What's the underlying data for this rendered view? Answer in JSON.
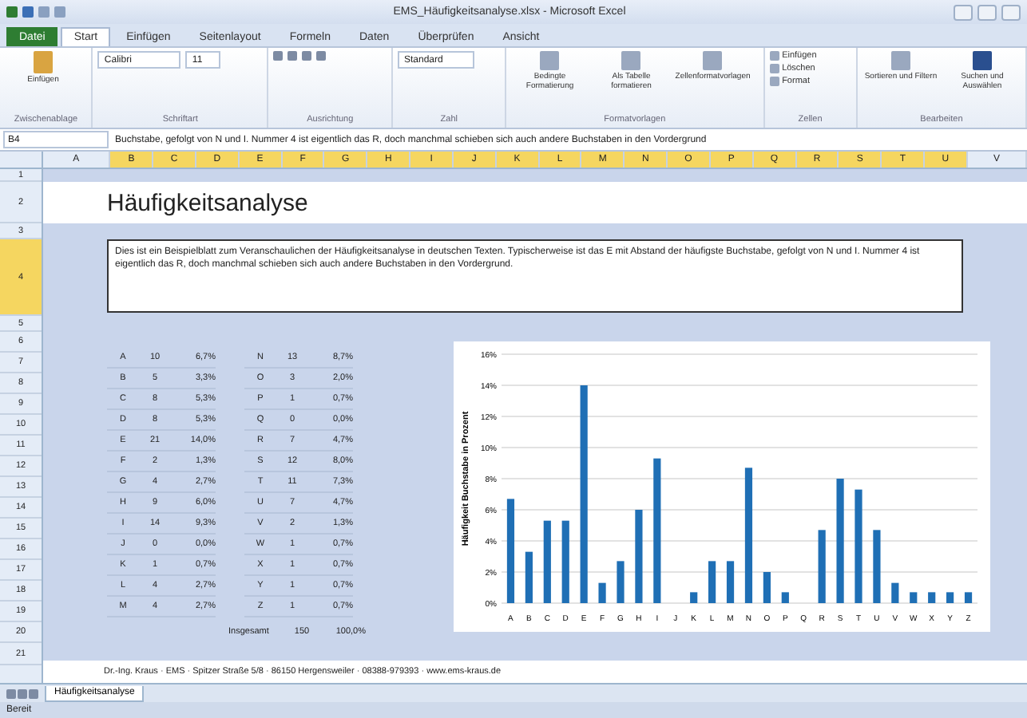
{
  "title_bar": {
    "title": "EMS_Häufigkeitsanalyse.xlsx - Microsoft Excel"
  },
  "ribbon": {
    "file_tab": "Datei",
    "tabs": [
      {
        "label": "Start",
        "selected": true
      },
      {
        "label": "Einfügen",
        "selected": false
      },
      {
        "label": "Seitenlayout",
        "selected": false
      },
      {
        "label": "Formeln",
        "selected": false
      },
      {
        "label": "Daten",
        "selected": false
      },
      {
        "label": "Überprüfen",
        "selected": false
      },
      {
        "label": "Ansicht",
        "selected": false
      }
    ],
    "paste_button": "Einfügen",
    "font": "Calibri",
    "font_size": "11",
    "number_format": "Standard",
    "style_buttons": [
      "Bedingte Formatierung",
      "Als Tabelle formatieren",
      "Zellenformatvorlagen"
    ],
    "cell_buttons": [
      "Einfügen",
      "Löschen",
      "Format"
    ],
    "edit_buttons": [
      "Sortieren und Filtern",
      "Suchen und Auswählen"
    ],
    "groups": [
      "Zwischenablage",
      "Schriftart",
      "Ausrichtung",
      "Zahl",
      "Formatvorlagen",
      "Zellen",
      "Bearbeiten"
    ]
  },
  "formula_bar": {
    "cell": "B4",
    "value": "Buchstabe, gefolgt von N und I. Nummer 4 ist eigentlich das R, doch manchmal schieben sich auch andere Buchstaben in den Vordergrund"
  },
  "columns": [
    {
      "label": "A",
      "selected": false
    },
    {
      "label": "B",
      "selected": true
    },
    {
      "label": "C",
      "selected": true
    },
    {
      "label": "D",
      "selected": true
    },
    {
      "label": "E",
      "selected": true
    },
    {
      "label": "F",
      "selected": true
    },
    {
      "label": "G",
      "selected": true
    },
    {
      "label": "H",
      "selected": true
    },
    {
      "label": "I",
      "selected": true
    },
    {
      "label": "J",
      "selected": true
    },
    {
      "label": "K",
      "selected": true
    },
    {
      "label": "L",
      "selected": true
    },
    {
      "label": "M",
      "selected": true
    },
    {
      "label": "N",
      "selected": true
    },
    {
      "label": "O",
      "selected": true
    },
    {
      "label": "P",
      "selected": true
    },
    {
      "label": "Q",
      "selected": true
    },
    {
      "label": "R",
      "selected": true
    },
    {
      "label": "S",
      "selected": true
    },
    {
      "label": "T",
      "selected": true
    },
    {
      "label": "U",
      "selected": true
    },
    {
      "label": "V",
      "selected": false
    }
  ],
  "row_numbers": [
    {
      "label": "1",
      "selected": false
    },
    {
      "label": "2",
      "selected": false
    },
    {
      "label": "3",
      "selected": false
    },
    {
      "label": "4",
      "selected": true
    },
    {
      "label": "5",
      "selected": false
    },
    {
      "label": "6",
      "selected": false
    },
    {
      "label": "7",
      "selected": false
    },
    {
      "label": "8",
      "selected": false
    },
    {
      "label": "9",
      "selected": false
    },
    {
      "label": "10",
      "selected": false
    },
    {
      "label": "11",
      "selected": false
    },
    {
      "label": "12",
      "selected": false
    },
    {
      "label": "13",
      "selected": false
    },
    {
      "label": "14",
      "selected": false
    },
    {
      "label": "15",
      "selected": false
    },
    {
      "label": "16",
      "selected": false
    },
    {
      "label": "17",
      "selected": false
    },
    {
      "label": "18",
      "selected": false
    },
    {
      "label": "19",
      "selected": false
    },
    {
      "label": "20",
      "selected": false
    },
    {
      "label": "21",
      "selected": false
    }
  ],
  "sheet": {
    "title": "Häufigkeitsanalyse",
    "description": "Dies ist ein Beispielblatt zum Veranschaulichen der Häufigkeitsanalyse in deutschen Texten. Typischerweise ist das E mit Abstand der häufigste Buchstabe, gefolgt von N und I. Nummer 4 ist eigentlich das R, doch manchmal schieben sich auch andere Buchstaben in den Vordergrund.",
    "table_left": [
      {
        "letter": "A",
        "count": "10",
        "percent": "6,7%"
      },
      {
        "letter": "B",
        "count": "5",
        "percent": "3,3%"
      },
      {
        "letter": "C",
        "count": "8",
        "percent": "5,3%"
      },
      {
        "letter": "D",
        "count": "8",
        "percent": "5,3%"
      },
      {
        "letter": "E",
        "count": "21",
        "percent": "14,0%"
      },
      {
        "letter": "F",
        "count": "2",
        "percent": "1,3%"
      },
      {
        "letter": "G",
        "count": "4",
        "percent": "2,7%"
      },
      {
        "letter": "H",
        "count": "9",
        "percent": "6,0%"
      },
      {
        "letter": "I",
        "count": "14",
        "percent": "9,3%"
      },
      {
        "letter": "J",
        "count": "0",
        "percent": "0,0%"
      },
      {
        "letter": "K",
        "count": "1",
        "percent": "0,7%"
      },
      {
        "letter": "L",
        "count": "4",
        "percent": "2,7%"
      },
      {
        "letter": "M",
        "count": "4",
        "percent": "2,7%"
      }
    ],
    "table_right": [
      {
        "letter": "N",
        "count": "13",
        "percent": "8,7%"
      },
      {
        "letter": "O",
        "count": "3",
        "percent": "2,0%"
      },
      {
        "letter": "P",
        "count": "1",
        "percent": "0,7%"
      },
      {
        "letter": "Q",
        "count": "0",
        "percent": "0,0%"
      },
      {
        "letter": "R",
        "count": "7",
        "percent": "4,7%"
      },
      {
        "letter": "S",
        "count": "12",
        "percent": "8,0%"
      },
      {
        "letter": "T",
        "count": "11",
        "percent": "7,3%"
      },
      {
        "letter": "U",
        "count": "7",
        "percent": "4,7%"
      },
      {
        "letter": "V",
        "count": "2",
        "percent": "1,3%"
      },
      {
        "letter": "W",
        "count": "1",
        "percent": "0,7%"
      },
      {
        "letter": "X",
        "count": "1",
        "percent": "0,7%"
      },
      {
        "letter": "Y",
        "count": "1",
        "percent": "0,7%"
      },
      {
        "letter": "Z",
        "count": "1",
        "percent": "0,7%"
      }
    ],
    "total": {
      "label": "Insgesamt",
      "count": "150",
      "percent": "100,0%"
    },
    "chart_data": {
      "type": "bar",
      "ylabel": "Häufigkeit Buchstabe in Prozent",
      "categories": [
        "A",
        "B",
        "C",
        "D",
        "E",
        "F",
        "G",
        "H",
        "I",
        "J",
        "K",
        "L",
        "M",
        "N",
        "O",
        "P",
        "Q",
        "R",
        "S",
        "T",
        "U",
        "V",
        "W",
        "X",
        "Y",
        "Z"
      ],
      "grid": true,
      "series": [
        {
          "color": "#1f6fb5",
          "values": [
            6.7,
            3.3,
            5.3,
            5.3,
            14.0,
            1.3,
            2.7,
            6.0,
            9.3,
            0,
            0.7,
            2.7,
            2.7,
            8.7,
            2.0,
            0.7,
            0,
            4.7,
            8.0,
            7.3,
            4.7,
            1.3,
            0.7,
            0.7,
            0.7,
            0.7
          ]
        }
      ],
      "ylim": [
        0,
        16
      ],
      "yticks": [
        {
          "value": 0,
          "label": "0%"
        },
        {
          "value": 2,
          "label": "2%"
        },
        {
          "value": 4,
          "label": "4%"
        },
        {
          "value": 6,
          "label": "6%"
        },
        {
          "value": 8,
          "label": "8%"
        },
        {
          "value": 10,
          "label": "10%"
        },
        {
          "value": 12,
          "label": "12%"
        },
        {
          "value": 14,
          "label": "14%"
        },
        {
          "value": 16,
          "label": "16%"
        }
      ]
    },
    "footer": "Dr.-Ing. Kraus · EMS · Spitzer Straße 5/8 · 86150 Hergensweiler · 08388-979393 · www.ems-kraus.de"
  },
  "sheet_tabs": [
    {
      "label": "Häufigkeitsanalyse",
      "selected": true
    }
  ],
  "status_bar": {
    "text": "Bereit"
  }
}
